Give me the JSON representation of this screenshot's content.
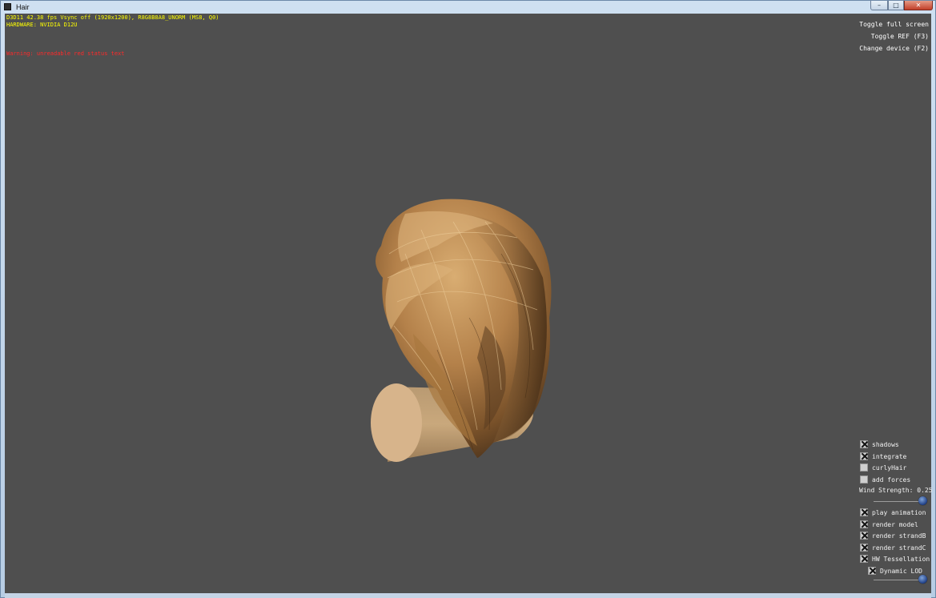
{
  "window": {
    "title": "Hair",
    "controls": {
      "minimize": "–",
      "maximize": "□",
      "close": "✕"
    }
  },
  "overlay": {
    "stats_line1": "D3D11 42.38 fps Vsync off (1920x1200), R8G8B8A8_UNORM (MS8, Q0)",
    "stats_line2": "HARDWARE: NVIDIA D12U",
    "warning": "Warning: unreadable red status text",
    "stats_color": "#ffff00",
    "warning_color": "#ff2a2a"
  },
  "buttons": {
    "toggle_full_screen": "Toggle full screen",
    "toggle_ref": "Toggle REF (F3)",
    "change_device": "Change device (F2)"
  },
  "controls": {
    "shadows": {
      "label": "shadows",
      "checked": true
    },
    "integrate": {
      "label": "integrate",
      "checked": true
    },
    "curly_hair": {
      "label": "curlyHair",
      "checked": false
    },
    "add_forces": {
      "label": "add forces",
      "checked": false
    },
    "wind_strength": {
      "label": "Wind Strength: 0.25",
      "value": 0.25
    },
    "play_animation": {
      "label": "play animation",
      "checked": true
    },
    "render_model": {
      "label": "render model",
      "checked": true
    },
    "render_strand_b": {
      "label": "render strandB",
      "checked": true
    },
    "render_strand_c": {
      "label": "render strandC",
      "checked": true
    },
    "hw_tessellation": {
      "label": "HW Tessellation",
      "checked": true
    },
    "dynamic_lod": {
      "label": "Dynamic LOD",
      "checked": true
    },
    "lod_slider": {
      "value": 0.95
    }
  },
  "colors": {
    "viewport_bg": "#4f4f4f",
    "hair": "#b8864c",
    "cylinder": "#d6b38a"
  }
}
